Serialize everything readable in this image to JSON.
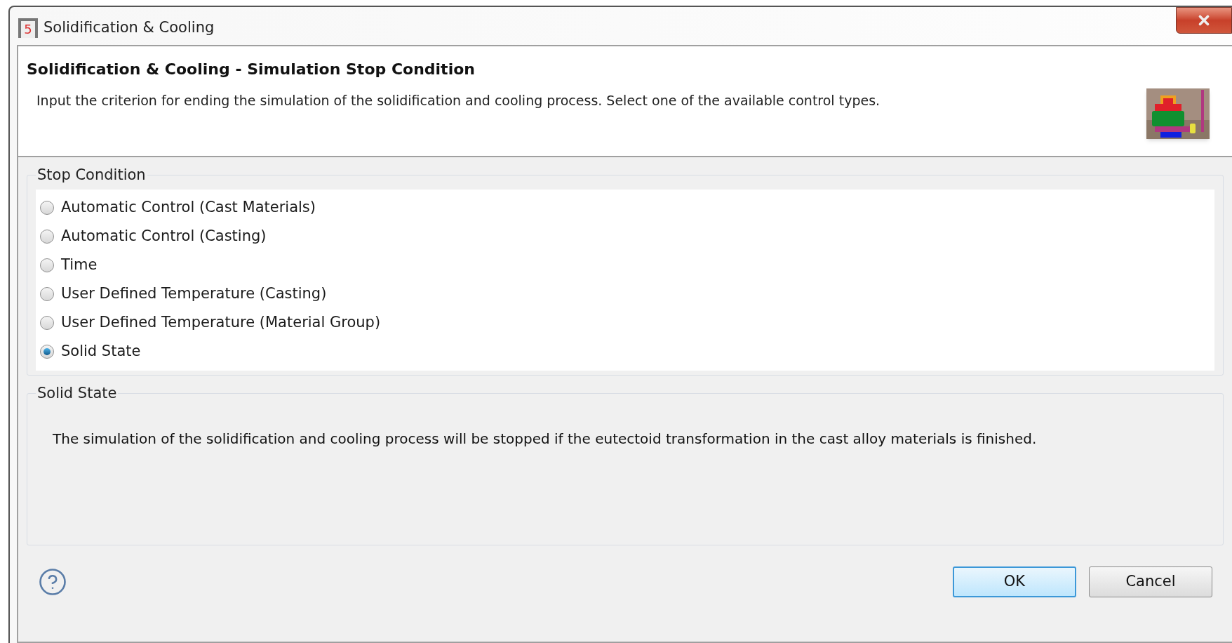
{
  "window": {
    "title": "Solidification & Cooling",
    "logo_text": "5"
  },
  "banner": {
    "title": "Solidification & Cooling - Simulation Stop Condition",
    "description": "Input the criterion for ending the simulation of the solidification and cooling process. Select one of the available control types."
  },
  "stop_condition": {
    "label": "Stop Condition",
    "options": [
      {
        "label": "Automatic Control (Cast Materials)",
        "selected": false
      },
      {
        "label": "Automatic Control (Casting)",
        "selected": false
      },
      {
        "label": "Time",
        "selected": false
      },
      {
        "label": "User Defined Temperature (Casting)",
        "selected": false
      },
      {
        "label": "User Defined Temperature (Material Group)",
        "selected": false
      },
      {
        "label": "Solid State",
        "selected": true
      }
    ]
  },
  "details": {
    "label": "Solid State",
    "text": "The simulation of the solidification and cooling process will be stopped if the eutectoid transformation in the cast alloy materials is finished."
  },
  "buttons": [
    {
      "label": "OK",
      "kind": "default"
    },
    {
      "label": "Cancel",
      "kind": "normal"
    }
  ]
}
